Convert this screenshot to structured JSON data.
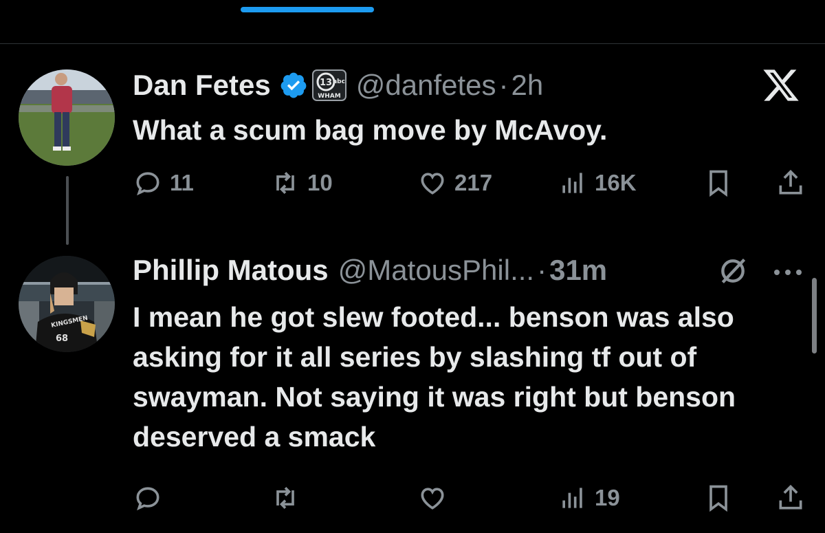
{
  "colors": {
    "accent": "#1d9bf0",
    "muted_text": "#8b9298",
    "background": "#000000",
    "text": "#e7e9ea"
  },
  "tweets": [
    {
      "name": "Dan Fetes",
      "handle": "@danfetes",
      "separator": "·",
      "time": "2h",
      "verified": true,
      "affiliation_badge": {
        "icon": "abc-13-wham-logo",
        "text_top": "abc",
        "text_bottom": "WHAM",
        "number": "13"
      },
      "text": "What a scum bag move by McAvoy.",
      "actions": {
        "replies": "11",
        "reposts": "10",
        "likes": "217",
        "views": "16K"
      }
    },
    {
      "name": "Phillip Matous",
      "handle": "@MatousPhil...",
      "separator": "·",
      "time": "31m",
      "verified": false,
      "text": "I mean he got slew footed... benson was also asking for it all series by slashing tf out of swayman. Not saying it was right but benson deserved a smack",
      "actions": {
        "replies": "",
        "reposts": "",
        "likes": "",
        "views": "19"
      }
    }
  ],
  "avatar_jersey": {
    "text": "KINGSMEN",
    "number": "68"
  },
  "icons": [
    "reply-icon",
    "repost-icon",
    "like-icon",
    "views-icon",
    "bookmark-icon",
    "share-icon",
    "x-logo-icon",
    "muted-icon",
    "more-icon",
    "verified-icon"
  ]
}
